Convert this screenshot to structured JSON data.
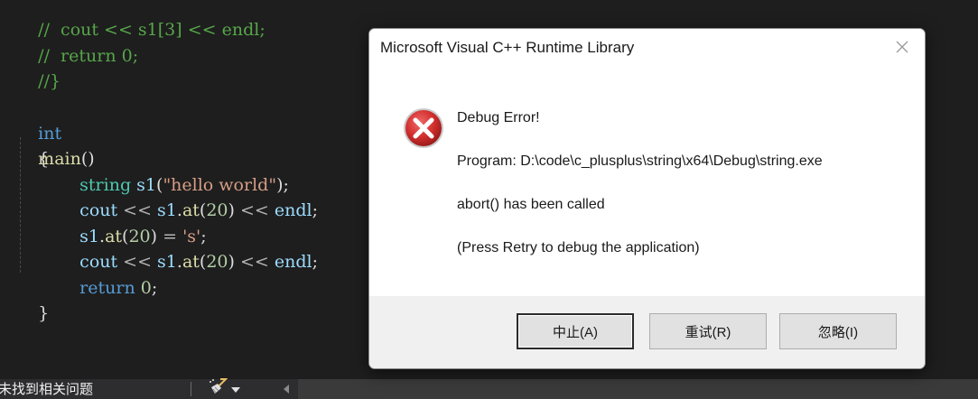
{
  "editor": {
    "lines": [
      {
        "comment": "//  cout << s1[3] << endl;"
      },
      {
        "comment": "//  return 0;"
      },
      {
        "comment": "//}"
      },
      {
        "kw": "int",
        "fn": "main",
        "rest": "()"
      },
      {
        "punc": "{"
      },
      {
        "type": "string",
        "var": "s1",
        "open": "(",
        "str": "\"hello world\"",
        "close": ");"
      },
      {
        "var1": "cout",
        "op1": " << ",
        "var2": "s1",
        "dot": ".",
        "fn": "at",
        "open": "(",
        "num": "20",
        "close": ")",
        "op2": " << ",
        "var3": "endl",
        "end": ";"
      },
      {
        "var": "s1",
        "dot": ".",
        "fn": "at",
        "open": "(",
        "num": "20",
        "close": ")",
        "op": " = ",
        "str": "'s'",
        "end": ";"
      },
      {
        "var1": "cout",
        "op1": " << ",
        "var2": "s1",
        "dot": ".",
        "fn": "at",
        "open": "(",
        "num": "20",
        "close": ")",
        "op2": " << ",
        "var3": "endl",
        "end": ";"
      },
      {
        "kw": "return",
        "num": "0",
        "end": ";"
      },
      {
        "punc": "}"
      }
    ]
  },
  "statusbar": {
    "message": "未找到相关问题",
    "brush_icon": "broom-icon",
    "dropdown_icon": "triangle-down-icon",
    "scroll_left_icon": "triangle-left-icon"
  },
  "dialog": {
    "title": "Microsoft Visual C++ Runtime Library",
    "close_icon": "close-icon",
    "icon": "error-icon",
    "heading": "Debug Error!",
    "program_line": "Program: D:\\code\\c_plusplus\\string\\x64\\Debug\\string.exe",
    "message": "abort() has been called",
    "hint": "(Press Retry to debug the application)",
    "buttons": {
      "abort": "中止(A)",
      "retry": "重试(R)",
      "ignore": "忽略(I)"
    }
  },
  "colors": {
    "editor_bg": "#1e1e1e",
    "comment": "#57a64a",
    "keyword": "#569cd6",
    "type": "#4ec9b0",
    "string": "#d69d85",
    "error_red": "#d32f2f"
  }
}
